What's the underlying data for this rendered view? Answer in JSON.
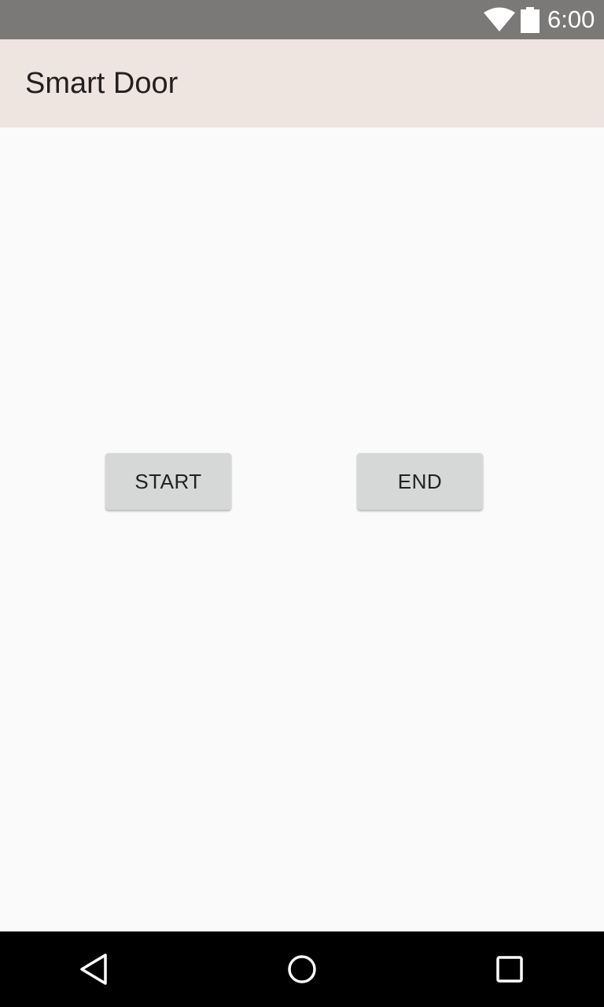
{
  "status_bar": {
    "time": "6:00",
    "wifi_icon": "wifi-icon",
    "battery_icon": "battery-icon"
  },
  "app_bar": {
    "title": "Smart Door"
  },
  "buttons": {
    "start_label": "START",
    "end_label": "END"
  },
  "nav_bar": {
    "back_icon": "back-icon",
    "home_icon": "home-icon",
    "recents_icon": "recents-icon"
  },
  "colors": {
    "status_bar": "#7b7878",
    "app_bar": "#efe5e0",
    "background": "#fafafa",
    "button": "#d6d7d7",
    "nav_bar": "#000000"
  }
}
